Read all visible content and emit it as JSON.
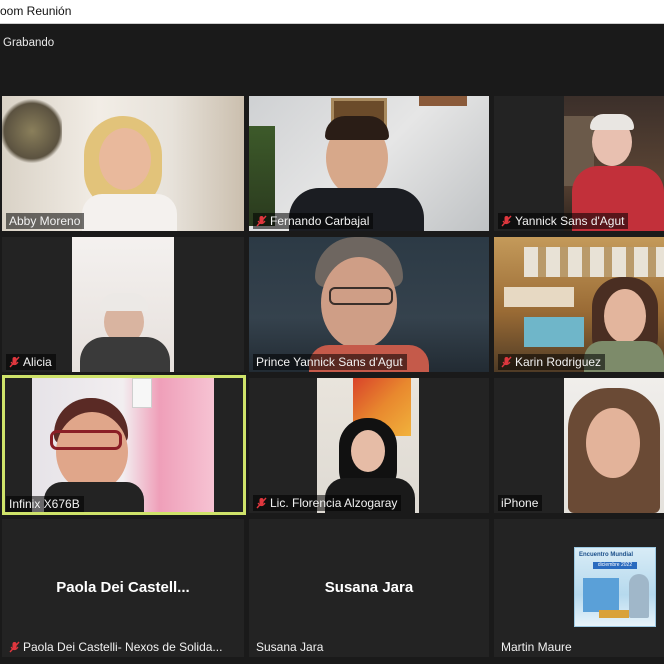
{
  "window": {
    "title": "oom Reunión"
  },
  "recording": {
    "label": "Grabando"
  },
  "colors": {
    "background": "#1a1a1a",
    "tile": "#232323",
    "active_speaker_border": "#cfe36a",
    "mute_icon": "#e0373e"
  },
  "participants": [
    {
      "name": "Abby Moreno",
      "muted": false
    },
    {
      "name": "Fernando Carbajal",
      "muted": true
    },
    {
      "name": "Yannick Sans d'Agut",
      "muted": true
    },
    {
      "name": "Alicia",
      "muted": true
    },
    {
      "name": "Prince Yannick Sans d'Agut",
      "muted": false
    },
    {
      "name": "Karin Rodriguez",
      "muted": true
    },
    {
      "name": "Infinix X676B",
      "muted": false,
      "active_speaker": true
    },
    {
      "name": "Lic. Florencia Alzogaray",
      "muted": true
    },
    {
      "name": "iPhone",
      "muted": false
    },
    {
      "name": "Paola Dei Castelli- Nexos de Solida...",
      "display_name": "Paola Dei Castell...",
      "muted": true,
      "video_off": true
    },
    {
      "name": "Susana Jara",
      "display_name": "Susana Jara",
      "muted": false,
      "video_off": true
    },
    {
      "name": "Martin Maure",
      "muted": false
    }
  ],
  "martin_poster": {
    "title": "Encuentro Mundial",
    "date": "diciembre 2022"
  }
}
